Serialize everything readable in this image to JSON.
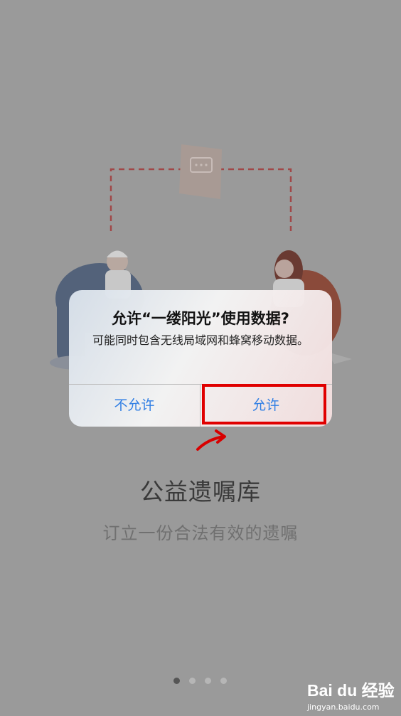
{
  "dialog": {
    "title": "允许“一缕阳光”使用数据?",
    "message": "可能同时包含无线局域网和蜂窝移动数据。",
    "deny_label": "不允许",
    "allow_label": "允许"
  },
  "page": {
    "title": "公益遗嘱库",
    "subtitle": "订立一份合法有效的遗嘱"
  },
  "pagination": {
    "count": 4,
    "active_index": 0
  },
  "watermark": {
    "logo": "Bai du 经验",
    "url": "jingyan.baidu.com"
  },
  "colors": {
    "overlay": "#9a9a9a",
    "button_text": "#2f7fe6",
    "highlight": "#e00000"
  }
}
